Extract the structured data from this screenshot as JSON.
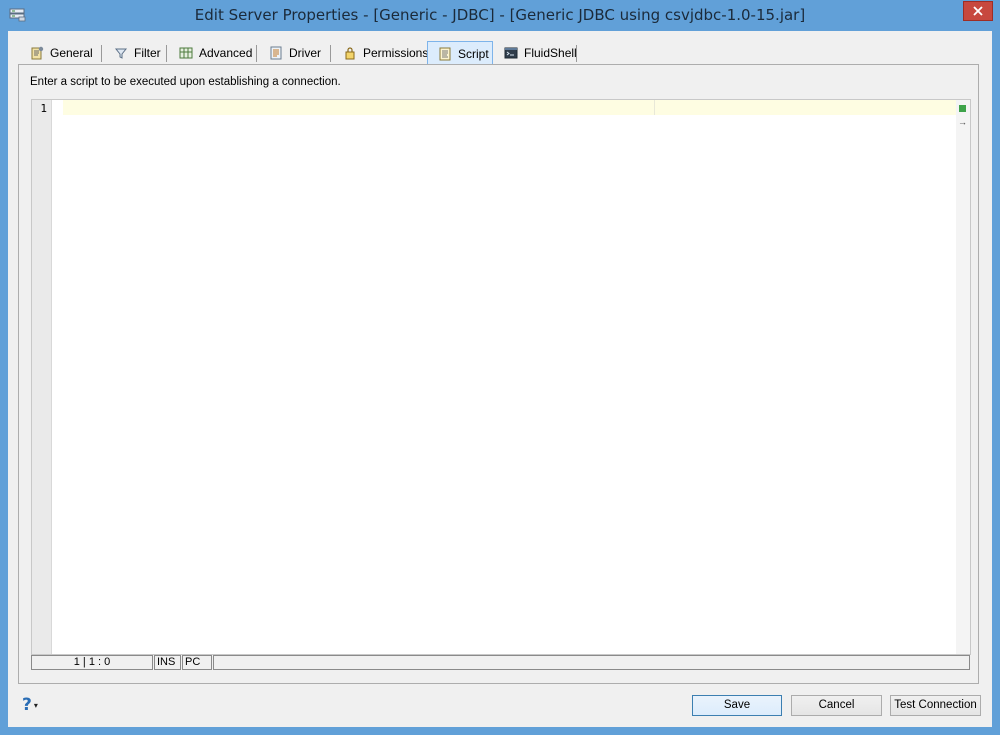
{
  "window": {
    "title": "Edit Server Properties - [Generic - JDBC] - [Generic JDBC using csvjdbc-1.0-15.jar]",
    "close_glyph": "✕"
  },
  "tabs": [
    {
      "label": "General",
      "icon": "general-icon"
    },
    {
      "label": "Filter",
      "icon": "filter-icon"
    },
    {
      "label": "Advanced",
      "icon": "advanced-icon"
    },
    {
      "label": "Driver",
      "icon": "driver-icon"
    },
    {
      "label": "Permissions",
      "icon": "permissions-icon"
    },
    {
      "label": "Script",
      "icon": "script-icon",
      "active": true
    },
    {
      "label": "FluidShell",
      "icon": "fluidshell-icon"
    }
  ],
  "script_panel": {
    "instruction": "Enter a script to be executed upon establishing a connection.",
    "editor": {
      "line_numbers": [
        "1"
      ],
      "content": ""
    },
    "status": {
      "position": "1 | 1 : 0",
      "mode": "INS",
      "line_ending": "PC"
    }
  },
  "footer": {
    "help_glyph": "?",
    "help_caret": "▾",
    "buttons": {
      "save": "Save",
      "cancel": "Cancel",
      "test": "Test Connection"
    }
  },
  "colors": {
    "titlebar": "#61a0d8",
    "close": "#c7483e",
    "active_tab": "#dcecfc",
    "current_line": "#fefde2"
  }
}
